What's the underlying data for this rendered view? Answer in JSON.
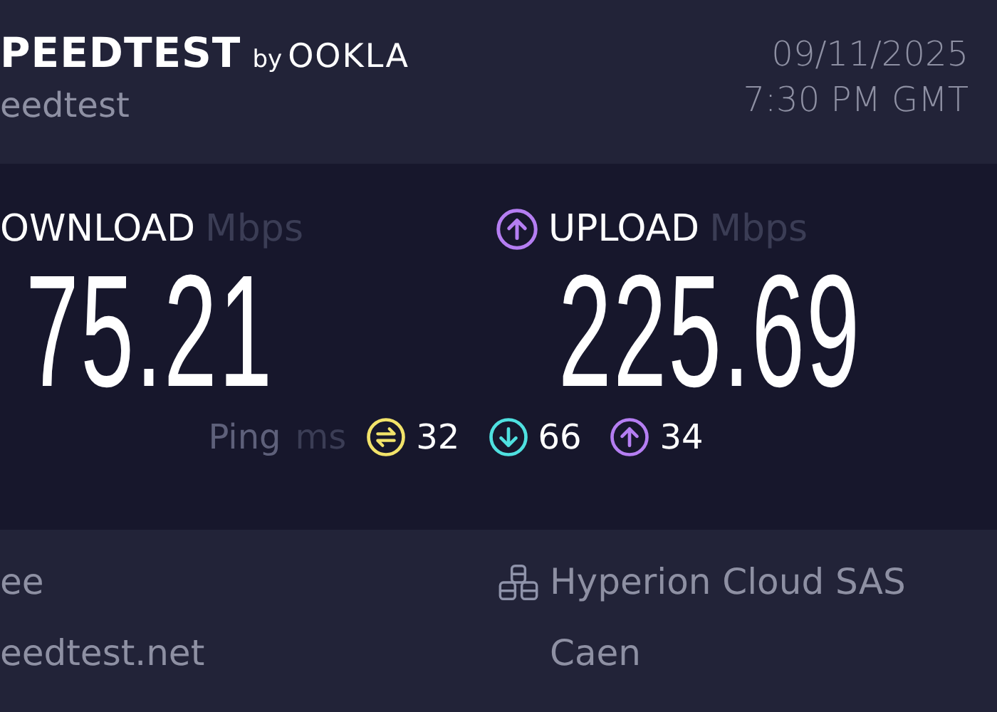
{
  "header": {
    "logo": {
      "word": "PEEDTEST",
      "by": "by",
      "brand": "OOKLA"
    },
    "subtitle": "eedtest",
    "date": "09/11/2025",
    "time": "7:30 PM GMT"
  },
  "results": [
    {
      "kind": "download",
      "label": "OWNLOAD",
      "unit": "Mbps",
      "value": "75.21"
    },
    {
      "kind": "upload",
      "label": "UPLOAD",
      "unit": "Mbps",
      "value": "225.69"
    }
  ],
  "ping": {
    "label": "Ping",
    "unit": "ms",
    "items": [
      {
        "kind": "idle",
        "value": "32",
        "color": "#f2e36a"
      },
      {
        "kind": "download",
        "value": "66",
        "color": "#4fe0e0"
      },
      {
        "kind": "upload",
        "value": "34",
        "color": "#b57ef2"
      }
    ]
  },
  "details": {
    "left": [
      "ee",
      "eedtest.net"
    ],
    "host": "Hyperion Cloud SAS",
    "location": "Caen"
  }
}
